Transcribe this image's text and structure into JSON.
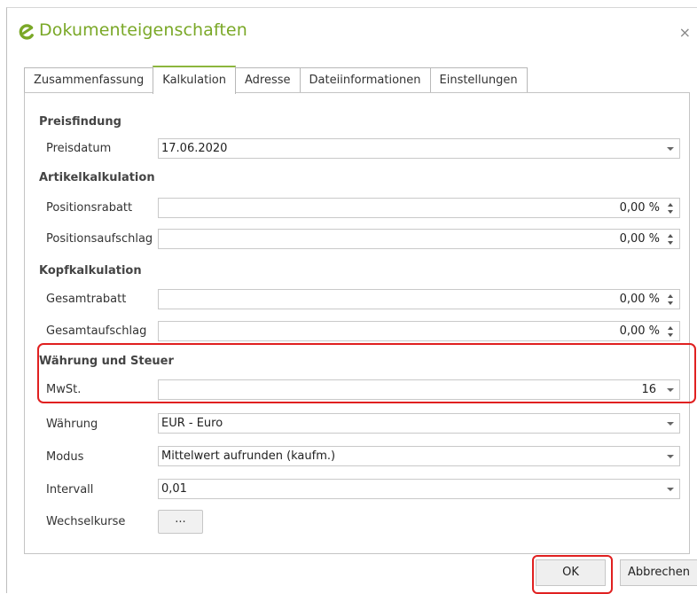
{
  "window": {
    "title": "Dokumenteigenschaften",
    "close_label": "×",
    "accent_color": "#7aa827"
  },
  "tabs": [
    {
      "label": "Zusammenfassung",
      "active": false
    },
    {
      "label": "Kalkulation",
      "active": true
    },
    {
      "label": "Adresse",
      "active": false
    },
    {
      "label": "Dateiinformationen",
      "active": false
    },
    {
      "label": "Einstellungen",
      "active": false
    }
  ],
  "preisfindung": {
    "heading": "Preisfindung",
    "preisdatum": {
      "label": "Preisdatum",
      "value": "17.06.2020"
    }
  },
  "artikelkalkulation": {
    "heading": "Artikelkalkulation",
    "positionsrabatt": {
      "label": "Positionsrabatt",
      "value": "0,00 %"
    },
    "positionsaufschlag": {
      "label": "Positionsaufschlag",
      "value": "0,00 %"
    }
  },
  "kopfkalkulation": {
    "heading": "Kopfkalkulation",
    "gesamtrabatt": {
      "label": "Gesamtrabatt",
      "value": "0,00 %"
    },
    "gesamtaufschlag": {
      "label": "Gesamtaufschlag",
      "value": "0,00 %"
    }
  },
  "waehrung_steuer": {
    "heading": "Währung und Steuer",
    "mwst": {
      "label": "MwSt.",
      "value": "16"
    },
    "waehrung": {
      "label": "Währung",
      "value": "EUR - Euro"
    },
    "modus": {
      "label": "Modus",
      "value": "Mittelwert aufrunden (kaufm.)"
    },
    "intervall": {
      "label": "Intervall",
      "value": "0,01"
    },
    "wechselkurse": {
      "label": "Wechselkurse",
      "button_label": "..."
    }
  },
  "footer": {
    "ok_label": "OK",
    "cancel_label": "Abbrechen"
  },
  "colors": {
    "highlight": "#e02020",
    "tab_active_border": "#8cb63d"
  }
}
